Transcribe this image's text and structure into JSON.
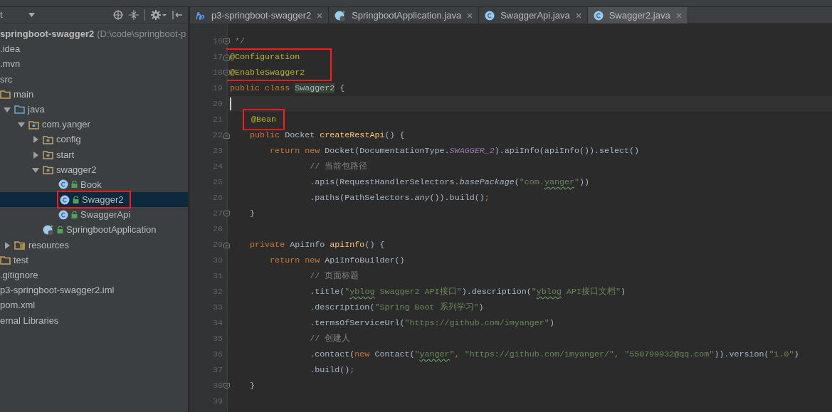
{
  "project_panel": {
    "view_selector": "t",
    "tree": [
      {
        "kind": "module",
        "label": "springboot-swagger2",
        "path": "(D:\\code\\springboot-p",
        "selected": false,
        "boxed": false,
        "children": [
          {
            "label": ".idea",
            "selected": false,
            "boxed": false
          },
          {
            "label": ".mvn",
            "selected": false,
            "boxed": false
          },
          {
            "label": "src",
            "selected": false,
            "boxed": false,
            "children": [
              {
                "kind": "folder",
                "label": "main",
                "selected": false,
                "boxed": false,
                "children": [
                  {
                    "kind": "source-folder",
                    "label": "java",
                    "expanded": true,
                    "selected": false,
                    "boxed": false,
                    "children": [
                      {
                        "kind": "package",
                        "label": "com.yanger",
                        "expanded": true,
                        "selected": false,
                        "boxed": false,
                        "children": [
                          {
                            "kind": "package",
                            "label": "config",
                            "expanded": false,
                            "selected": false,
                            "boxed": false
                          },
                          {
                            "kind": "package",
                            "label": "start",
                            "expanded": false,
                            "selected": false,
                            "boxed": false
                          },
                          {
                            "kind": "package",
                            "label": "swagger2",
                            "expanded": true,
                            "selected": false,
                            "boxed": false,
                            "children": [
                              {
                                "kind": "class",
                                "label": "Book",
                                "selected": false,
                                "boxed": false
                              },
                              {
                                "kind": "class",
                                "label": "Swagger2",
                                "selected": true,
                                "boxed": true
                              },
                              {
                                "kind": "class",
                                "label": "SwaggerApi",
                                "selected": false,
                                "boxed": false
                              }
                            ]
                          },
                          {
                            "kind": "app-class",
                            "label": "SpringbootApplication",
                            "selected": false,
                            "boxed": false
                          }
                        ]
                      }
                    ]
                  },
                  {
                    "kind": "resources-folder",
                    "label": "resources",
                    "expanded": false,
                    "selected": false,
                    "boxed": false
                  }
                ]
              },
              {
                "kind": "folder",
                "label": "test",
                "selected": false,
                "boxed": false
              }
            ]
          },
          {
            "label": ".gitignore",
            "selected": false,
            "boxed": false
          },
          {
            "label": "p3-springboot-swagger2.iml",
            "selected": false,
            "boxed": false
          },
          {
            "label": "pom.xml",
            "selected": false,
            "boxed": false
          }
        ]
      },
      {
        "label": "ernal Libraries",
        "selected": false,
        "boxed": false
      }
    ]
  },
  "tabs": [
    {
      "kind": "module",
      "label": "p3-springboot-swagger2",
      "selected": false
    },
    {
      "kind": "app-class",
      "label": "SpringbootApplication.java",
      "selected": false
    },
    {
      "kind": "class",
      "label": "SwaggerApi.java",
      "selected": false
    },
    {
      "kind": "class",
      "label": "Swagger2.java",
      "selected": true
    }
  ],
  "editor": {
    "lines": [
      {
        "number": "16",
        "kind": "fold-end",
        "current": false,
        "boxed": false,
        "tokens": [
          {
            "kind": "comment",
            "text": " */"
          }
        ]
      },
      {
        "number": "17",
        "kind": "fold-start",
        "current": false,
        "boxed": true,
        "tokens": [
          {
            "kind": "annotation",
            "text": "@Configuration"
          }
        ]
      },
      {
        "number": "18",
        "kind": "fold-end",
        "current": false,
        "boxed": true,
        "tokens": [
          {
            "kind": "annotation",
            "text": "@EnableSwagger2"
          }
        ]
      },
      {
        "number": "19",
        "kind": "plain",
        "current": false,
        "boxed": false,
        "tokens": [
          {
            "kind": "keyword",
            "text": "public class "
          },
          {
            "kind": "plain",
            "text": "Swagger2",
            "highlighted": true
          },
          {
            "kind": "plain",
            "text": " {"
          }
        ]
      },
      {
        "number": "20",
        "kind": "plain",
        "current": true,
        "boxed": false
      },
      {
        "number": "21",
        "kind": "plain",
        "current": false,
        "boxed": false,
        "tokens": [
          {
            "kind": "annotation",
            "text": "    @Bean",
            "boxed": true
          }
        ]
      },
      {
        "number": "22",
        "kind": "fold-start",
        "current": false,
        "boxed": false,
        "tokens": [
          {
            "kind": "keyword",
            "text": "    public "
          },
          {
            "kind": "plain",
            "text": "Docket "
          },
          {
            "kind": "method",
            "text": "createRestApi"
          },
          {
            "kind": "plain",
            "text": "() {"
          }
        ]
      },
      {
        "number": "23",
        "kind": "plain",
        "current": false,
        "boxed": false,
        "tokens": [
          {
            "kind": "keyword",
            "text": "        return new "
          },
          {
            "kind": "plain",
            "text": "Docket(DocumentationType."
          },
          {
            "kind": "static",
            "text": "SWAGGER_2"
          },
          {
            "kind": "plain",
            "text": ").apiInfo(apiInfo()).select()"
          }
        ]
      },
      {
        "number": "24",
        "kind": "plain",
        "current": false,
        "boxed": false,
        "tokens": [
          {
            "kind": "comment",
            "text": "                // 当前包路径"
          }
        ]
      },
      {
        "number": "25",
        "kind": "plain",
        "current": false,
        "boxed": false,
        "tokens": [
          {
            "kind": "plain",
            "text": "                .apis(RequestHandlerSelectors."
          },
          {
            "kind": "call",
            "text": "basePackage"
          },
          {
            "kind": "plain",
            "text": "("
          },
          {
            "kind": "string",
            "text": "\"com."
          },
          {
            "kind": "string",
            "text": "yanger",
            "typo": true
          },
          {
            "kind": "string",
            "text": "\""
          },
          {
            "kind": "plain",
            "text": "))"
          }
        ]
      },
      {
        "number": "26",
        "kind": "plain",
        "current": false,
        "boxed": false,
        "tokens": [
          {
            "kind": "plain",
            "text": "                .paths(PathSelectors."
          },
          {
            "kind": "call",
            "text": "any"
          },
          {
            "kind": "plain",
            "text": "()).build()"
          },
          {
            "kind": "keyword",
            "text": ";"
          }
        ]
      },
      {
        "number": "27",
        "kind": "fold-end",
        "current": false,
        "boxed": false,
        "tokens": [
          {
            "kind": "plain",
            "text": "    }"
          }
        ]
      },
      {
        "number": "28",
        "kind": "plain",
        "current": false,
        "boxed": false
      },
      {
        "number": "29",
        "kind": "fold-start",
        "current": false,
        "boxed": false,
        "tokens": [
          {
            "kind": "keyword",
            "text": "    private "
          },
          {
            "kind": "plain",
            "text": "ApiInfo "
          },
          {
            "kind": "method",
            "text": "apiInfo"
          },
          {
            "kind": "plain",
            "text": "() {"
          }
        ]
      },
      {
        "number": "30",
        "kind": "plain",
        "current": false,
        "boxed": false,
        "tokens": [
          {
            "kind": "keyword",
            "text": "        return new "
          },
          {
            "kind": "plain",
            "text": "ApiInfoBuilder()"
          }
        ]
      },
      {
        "number": "31",
        "kind": "plain",
        "current": false,
        "boxed": false,
        "tokens": [
          {
            "kind": "comment",
            "text": "                // 页面标题"
          }
        ]
      },
      {
        "number": "32",
        "kind": "plain",
        "current": false,
        "boxed": false,
        "tokens": [
          {
            "kind": "plain",
            "text": "                .title("
          },
          {
            "kind": "string",
            "text": "\""
          },
          {
            "kind": "string",
            "text": "yblog",
            "typo": true
          },
          {
            "kind": "string",
            "text": " Swagger2 API接口\""
          },
          {
            "kind": "plain",
            "text": ").description("
          },
          {
            "kind": "string",
            "text": "\""
          },
          {
            "kind": "string",
            "text": "yblog",
            "typo": true
          },
          {
            "kind": "string",
            "text": " API接口文档\""
          },
          {
            "kind": "plain",
            "text": ")"
          }
        ]
      },
      {
        "number": "33",
        "kind": "plain",
        "current": false,
        "boxed": false,
        "tokens": [
          {
            "kind": "plain",
            "text": "                .description("
          },
          {
            "kind": "string",
            "text": "\"Spring Boot 系列学习\""
          },
          {
            "kind": "plain",
            "text": ")"
          }
        ]
      },
      {
        "number": "34",
        "kind": "plain",
        "current": false,
        "boxed": false,
        "tokens": [
          {
            "kind": "plain",
            "text": "                .termsOfServiceUrl("
          },
          {
            "kind": "string",
            "text": "\"https://github.com/imyanger\""
          },
          {
            "kind": "plain",
            "text": ")"
          }
        ]
      },
      {
        "number": "35",
        "kind": "plain",
        "current": false,
        "boxed": false,
        "tokens": [
          {
            "kind": "comment",
            "text": "                // 创建人"
          }
        ]
      },
      {
        "number": "36",
        "kind": "plain",
        "current": false,
        "boxed": false,
        "tokens": [
          {
            "kind": "plain",
            "text": "                .contact("
          },
          {
            "kind": "keyword",
            "text": "new "
          },
          {
            "kind": "plain",
            "text": "Contact("
          },
          {
            "kind": "string",
            "text": "\""
          },
          {
            "kind": "string",
            "text": "yanger",
            "typo": true
          },
          {
            "kind": "string",
            "text": "\""
          },
          {
            "kind": "keyword",
            "text": ", "
          },
          {
            "kind": "string",
            "text": "\"https://github.com/imyanger/\""
          },
          {
            "kind": "keyword",
            "text": ", "
          },
          {
            "kind": "string",
            "text": "\"550799932@qq.com\""
          },
          {
            "kind": "plain",
            "text": ")).version("
          },
          {
            "kind": "string",
            "text": "\"1.0\""
          },
          {
            "kind": "plain",
            "text": ")"
          }
        ]
      },
      {
        "number": "37",
        "kind": "plain",
        "current": false,
        "boxed": false,
        "tokens": [
          {
            "kind": "plain",
            "text": "                .build()"
          },
          {
            "kind": "keyword",
            "text": ";"
          }
        ]
      },
      {
        "number": "38",
        "kind": "fold-end",
        "current": false,
        "boxed": false,
        "tokens": [
          {
            "kind": "plain",
            "text": "    }"
          }
        ]
      },
      {
        "number": "39",
        "kind": "plain",
        "current": false,
        "boxed": false
      }
    ]
  }
}
